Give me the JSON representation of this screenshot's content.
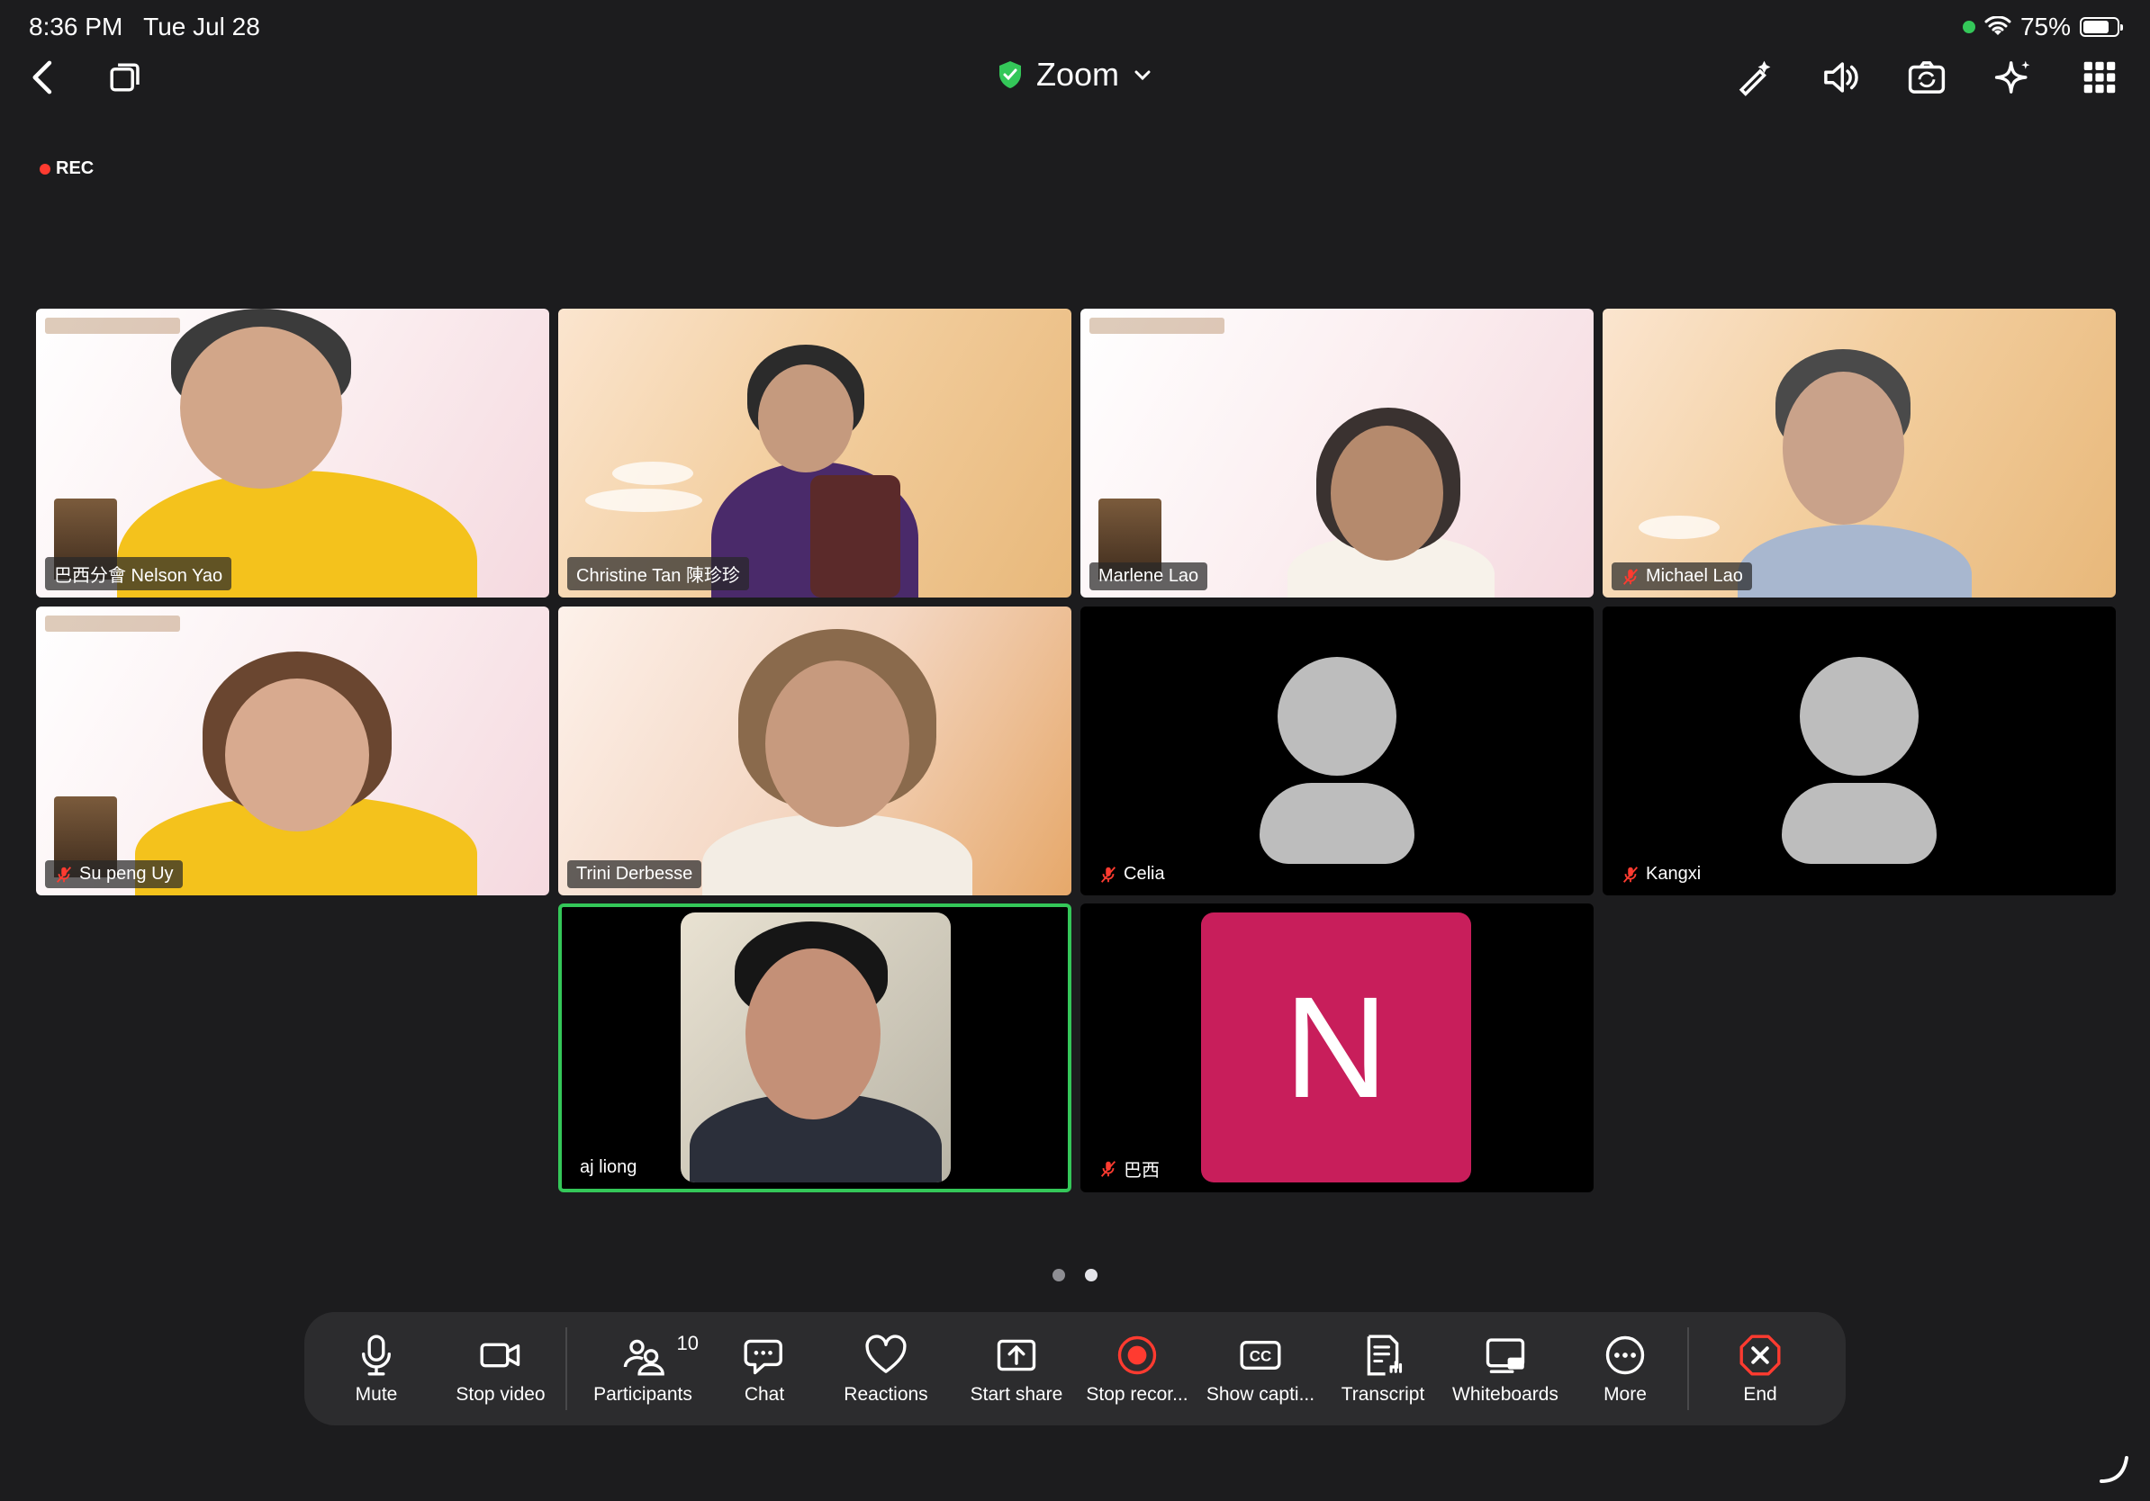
{
  "status": {
    "time": "8:36 PM",
    "date": "Tue Jul 28",
    "battery": "75%",
    "battery_level": 0.75
  },
  "header": {
    "title": "Zoom",
    "rec_label": "REC"
  },
  "participants": [
    {
      "name": "巴西分會 Nelson Yao",
      "muted": false
    },
    {
      "name": "Christine Tan 陳珍珍",
      "muted": false
    },
    {
      "name": "Marlene Lao",
      "muted": false
    },
    {
      "name": "Michael Lao",
      "muted": true
    },
    {
      "name": "Su peng Uy",
      "muted": true
    },
    {
      "name": "Trini Derbesse",
      "muted": false
    },
    {
      "name": "Celia",
      "muted": true
    },
    {
      "name": "Kangxi",
      "muted": true
    },
    {
      "name": "aj liong",
      "muted": false,
      "active_speaker": true
    },
    {
      "name": "巴西",
      "muted": true,
      "initial": "N"
    }
  ],
  "pagination": {
    "pages": 2,
    "current": 2
  },
  "toolbar": {
    "mute": "Mute",
    "stop_video": "Stop video",
    "participants": "Participants",
    "participants_count": "10",
    "chat": "Chat",
    "reactions": "Reactions",
    "start_share": "Start share",
    "stop_recording": "Stop recor...",
    "show_captions": "Show capti...",
    "transcript": "Transcript",
    "whiteboards": "Whiteboards",
    "more": "More",
    "end": "End"
  },
  "colors": {
    "background": "#1c1c1e",
    "toolbar": "#2c2c2e",
    "active_border": "#34c759",
    "end": "#ff3b30",
    "avatar_n": "#c81e5b"
  }
}
